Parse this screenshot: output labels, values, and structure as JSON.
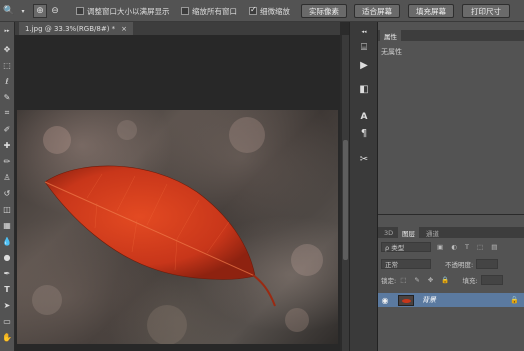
{
  "options_bar": {
    "zoom_in_glyph": "⊕",
    "zoom_out_glyph": "⊖",
    "resize_windows_label": "调整窗口大小以满屏显示",
    "zoom_all_windows_label": "缩放所有窗口",
    "scrubby_zoom_label": "细微缩放",
    "actual_pixels_label": "实际像素",
    "fit_screen_label": "适合屏幕",
    "fill_screen_label": "填充屏幕",
    "print_size_label": "打印尺寸"
  },
  "document": {
    "tab_title": "1.jpg @ 33.3%(RGB/8#) *",
    "close_glyph": "×"
  },
  "properties_panel": {
    "tab_label": "属性",
    "content": "无属性"
  },
  "layers_panel": {
    "tabs": [
      "3D",
      "图层",
      "通道"
    ],
    "kind_label": "ρ 类型",
    "blend_mode": "正常",
    "opacity_label": "不透明度:",
    "lock_label": "锁定:",
    "fill_label": "填充:",
    "layer_name": "背景"
  },
  "colors": {
    "leaf": "#c8361a",
    "layer_selected": "#5b7aa0"
  }
}
